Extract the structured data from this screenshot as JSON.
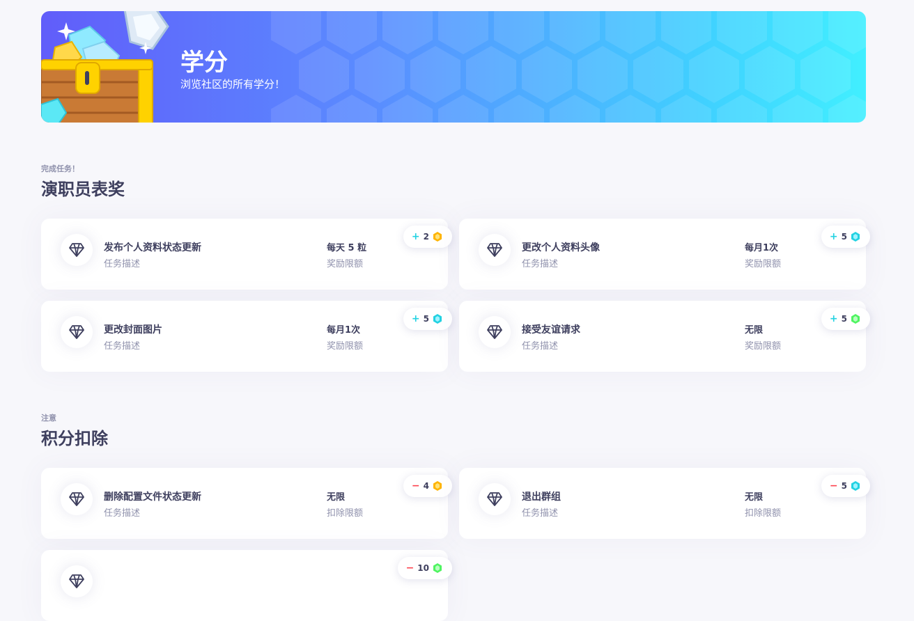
{
  "banner": {
    "title": "学分",
    "subtitle": "浏览社区的所有学分！"
  },
  "sections": [
    {
      "pretitle": "完成任务！",
      "title": "演职员表奖",
      "cards": [
        {
          "name": "发布个人资料状态更新",
          "desc": "任务描述",
          "limit": "每天 5 粒",
          "limit_label": "奖励限额",
          "sign": "+",
          "amount": "2",
          "gem": "gold"
        },
        {
          "name": "更改个人资料头像",
          "desc": "任务描述",
          "limit": "每月1次",
          "limit_label": "奖励限额",
          "sign": "+",
          "amount": "5",
          "gem": "blue"
        },
        {
          "name": "更改封面图片",
          "desc": "任务描述",
          "limit": "每月1次",
          "limit_label": "奖励限额",
          "sign": "+",
          "amount": "5",
          "gem": "blue"
        },
        {
          "name": "接受友谊请求",
          "desc": "任务描述",
          "limit": "无限",
          "limit_label": "奖励限额",
          "sign": "+",
          "amount": "5",
          "gem": "green"
        }
      ]
    },
    {
      "pretitle": "注意",
      "title": "积分扣除",
      "cards": [
        {
          "name": "删除配置文件状态更新",
          "desc": "任务描述",
          "limit": "无限",
          "limit_label": "扣除限额",
          "sign": "−",
          "amount": "4",
          "gem": "gold"
        },
        {
          "name": "退出群组",
          "desc": "任务描述",
          "limit": "无限",
          "limit_label": "扣除限额",
          "sign": "−",
          "amount": "5",
          "gem": "blue"
        },
        {
          "name": "",
          "desc": "",
          "limit": "",
          "limit_label": "",
          "sign": "−",
          "amount": "10",
          "gem": "green"
        }
      ]
    }
  ],
  "colors": {
    "gold": "#ffb400",
    "blue": "#23d2e2",
    "green": "#4ff461",
    "plus": "#23d2e2",
    "minus": "#fd434f"
  }
}
